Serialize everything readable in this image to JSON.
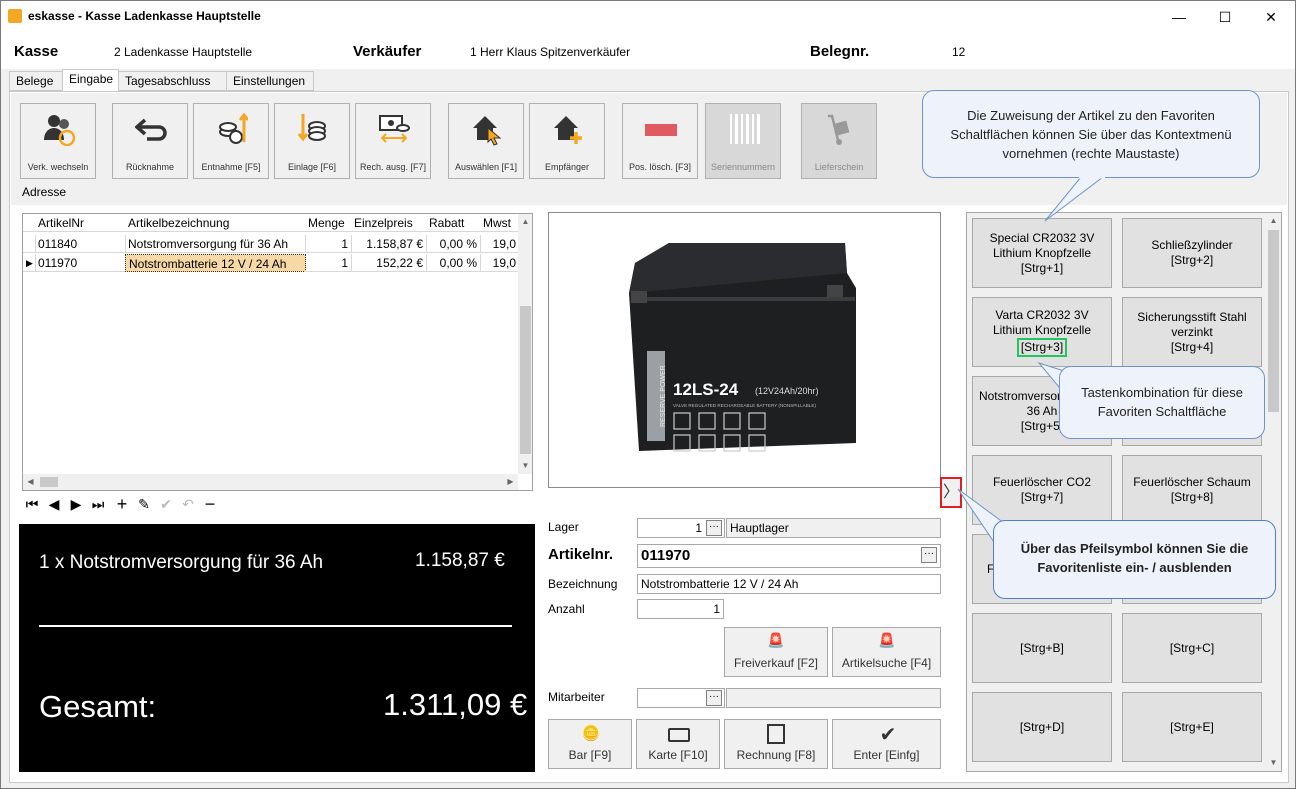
{
  "window": {
    "title": "eskasse - Kasse Ladenkasse Hauptstelle",
    "min": "—",
    "max": "☐",
    "close": "✕"
  },
  "header": {
    "kasse_label": "Kasse",
    "kasse_value": "2  Ladenkasse Hauptstelle",
    "verkaeufer_label": "Verkäufer",
    "verkaeufer_value": "1  Herr Klaus Spitzenverkäufer",
    "belegnr_label": "Belegnr.",
    "belegnr_value": "12"
  },
  "tabs": [
    "Belege",
    "Eingabe",
    "Tagesabschluss",
    "Einstellungen"
  ],
  "toolbar": [
    {
      "label": "Verk. wechseln",
      "icon": "users-icon"
    },
    {
      "label": "Rücknahme",
      "icon": "return-arrow-icon"
    },
    {
      "label": "Entnahme [F5]",
      "icon": "coins-out-icon"
    },
    {
      "label": "Einlage [F6]",
      "icon": "coins-in-icon"
    },
    {
      "label": "Rech. ausg. [F7]",
      "icon": "invoice-icon"
    },
    {
      "label": "Auswählen [F1]",
      "icon": "home-select-icon"
    },
    {
      "label": "Empfänger",
      "icon": "home-add-icon"
    },
    {
      "label": "Pos. lösch. [F3]",
      "icon": "minus-icon"
    },
    {
      "label": "Seriennummern",
      "icon": "barcode-icon"
    },
    {
      "label": "Lieferschein",
      "icon": "handtruck-icon"
    }
  ],
  "adresse_label": "Adresse",
  "grid": {
    "columns": [
      "ArtikelNr",
      "Artikelbezeichnung",
      "Menge",
      "Einzelpreis",
      "Rabatt",
      "Mwst"
    ],
    "rows": [
      [
        "011840",
        "Notstromversorgung für 36 Ah",
        "1",
        "1.158,87 €",
        "0,00 %",
        "19,0"
      ],
      [
        "011970",
        "Notstrombatterie 12 V / 24 Ah",
        "1",
        "152,22 €",
        "0,00 %",
        "19,0"
      ]
    ]
  },
  "display": {
    "line_text": "1 x Notstromversorgung für 36 Ah",
    "line_price": "1.158,87 €",
    "total_label": "Gesamt:",
    "total_value": "1.311,09 €"
  },
  "form": {
    "lager_label": "Lager",
    "lager_num": "1",
    "lager_name": "Hauptlager",
    "artikelnr_label": "Artikelnr.",
    "artikelnr_value": "011970",
    "bezeichnung_label": "Bezeichnung",
    "bezeichnung_value": "Notstrombatterie 12 V / 24 Ah",
    "anzahl_label": "Anzahl",
    "anzahl_value": "1",
    "mitarbeiter_label": "Mitarbeiter",
    "freiverkauf": "Freiverkauf [F2]",
    "artikelsuche": "Artikelsuche [F4]"
  },
  "pay": [
    "Bar [F9]",
    "Karte [F10]",
    "Rechnung [F8]",
    "Enter [Einfg]"
  ],
  "product_image": {
    "model": "12LS-24",
    "spec": "(12V24Ah/20hr)",
    "side_text": "RESERVE POWER",
    "sub_text": "VALVE REGULATED RECHARGEABLE BATTERY (NONSPILLABLE)"
  },
  "favorites": [
    [
      "Special CR2032 3V",
      "Lithium Knopfzelle",
      "[Strg+1]"
    ],
    [
      "Schließzylinder",
      "[Strg+2]"
    ],
    [
      "Varta CR2032 3V",
      "Lithium Knopfzelle",
      "[Strg+3]"
    ],
    [
      "Sicherungsstift Stahl",
      "verzinkt",
      "[Strg+4]"
    ],
    [
      "Notstromversorgung für",
      "36 Ah",
      "[Strg+5]"
    ],
    [
      "",
      ""
    ],
    [
      "Feuerlöscher CO2",
      "[Strg+7]"
    ],
    [
      "Feuerlöscher Schaum",
      "[Strg+8]"
    ],
    [
      "Fe"
    ],
    [
      ""
    ],
    [
      "[Strg+B]"
    ],
    [
      "[Strg+C]"
    ],
    [
      "[Strg+D]"
    ],
    [
      "[Strg+E]"
    ]
  ],
  "toggle_arrow": "〉",
  "callouts": [
    "Die Zuweisung der Artikel zu den Favoriten Schaltflächen können Sie über das Kontextmenü vornehmen (rechte Maustaste)",
    "Tastenkombination für diese Favoriten Schaltfläche",
    "Über das Pfeilsymbol können Sie die Favoritenliste ein- / ausblenden"
  ],
  "colors": {
    "accent_highlight": "#f7d9a8",
    "display_bg": "#000000",
    "callout_border": "#6f93c8",
    "key_highlight": "#22c55e",
    "toggle_border": "#e02020"
  }
}
